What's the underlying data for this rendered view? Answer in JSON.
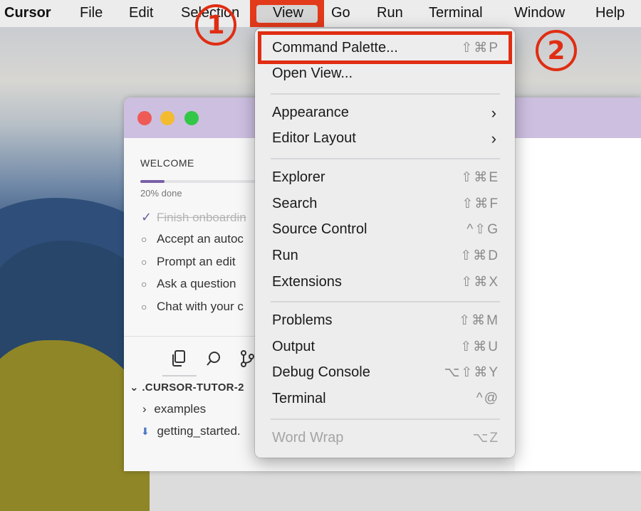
{
  "menubar": {
    "app": "Cursor",
    "items": [
      "File",
      "Edit",
      "Selection",
      "View",
      "Go",
      "Run",
      "Terminal",
      "Window",
      "Help"
    ]
  },
  "annotations": [
    "1",
    "2"
  ],
  "colors": {
    "annotation": "#e02d12",
    "accent": "#7a5fa8",
    "titlebar": "#cdbfe0"
  },
  "view_menu": {
    "items": [
      {
        "label": "Command Palette...",
        "shortcut": "⇧⌘P"
      },
      {
        "label": "Open View...",
        "shortcut": ""
      },
      {
        "label": "Appearance",
        "submenu": "›"
      },
      {
        "label": "Editor Layout",
        "submenu": "›"
      },
      {
        "label": "Explorer",
        "shortcut": "⇧⌘E"
      },
      {
        "label": "Search",
        "shortcut": "⇧⌘F"
      },
      {
        "label": "Source Control",
        "shortcut": "^⇧G"
      },
      {
        "label": "Run",
        "shortcut": "⇧⌘D"
      },
      {
        "label": "Extensions",
        "shortcut": "⇧⌘X"
      },
      {
        "label": "Problems",
        "shortcut": "⇧⌘M"
      },
      {
        "label": "Output",
        "shortcut": "⇧⌘U"
      },
      {
        "label": "Debug Console",
        "shortcut": "⌥⇧⌘Y"
      },
      {
        "label": "Terminal",
        "shortcut": "^@"
      },
      {
        "label": "Word Wrap",
        "shortcut": "⌥Z",
        "disabled": true
      }
    ]
  },
  "welcome": {
    "title": "WELCOME",
    "progress_fraction": 0.2,
    "progress_text": "20% done",
    "tasks": [
      {
        "label": "Finish onboardin",
        "mark": "✓",
        "done": true
      },
      {
        "label": "Accept an autoc",
        "mark": "○"
      },
      {
        "label": "Prompt an edit",
        "mark": "○"
      },
      {
        "label": "Ask a question",
        "mark": "○"
      },
      {
        "label": "Chat with your c",
        "mark": "○"
      }
    ]
  },
  "activity_icons": [
    "files-icon",
    "search-icon",
    "source-control-icon"
  ],
  "explorer": {
    "header": ".CURSOR-TUTOR-2",
    "header_chevron": "⌄",
    "items": [
      {
        "label": "examples",
        "glyph": "›"
      },
      {
        "label": "getting_started.",
        "glyph": "⬇"
      }
    ]
  }
}
